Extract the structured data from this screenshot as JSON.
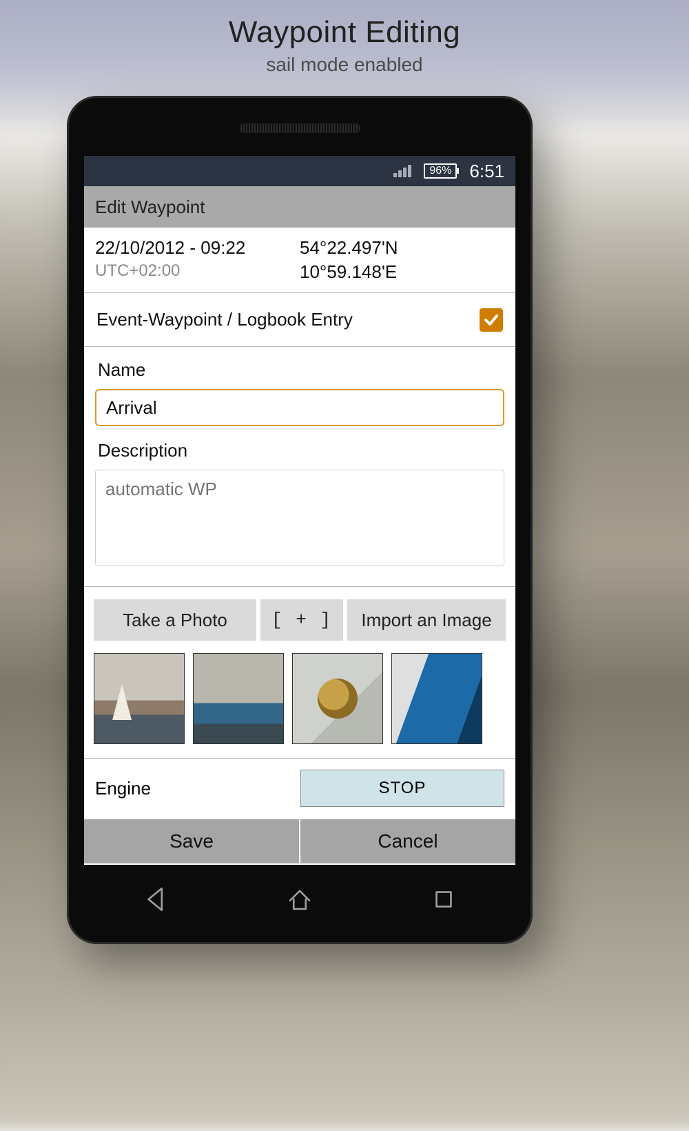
{
  "page": {
    "title": "Waypoint Editing",
    "subtitle": "sail mode enabled"
  },
  "status": {
    "battery": "96%",
    "time": "6:51"
  },
  "header": {
    "title": "Edit Waypoint"
  },
  "info": {
    "datetime": "22/10/2012 - 09:22",
    "timezone": "UTC+02:00",
    "latitude": "54°22.497'N",
    "longitude": "10°59.148'E"
  },
  "event": {
    "label": "Event-Waypoint / Logbook Entry",
    "checked": true
  },
  "form": {
    "name_label": "Name",
    "name_value": "Arrival",
    "desc_label": "Description",
    "desc_placeholder": "automatic WP"
  },
  "photos": {
    "take_label": "Take a Photo",
    "add_label": "[ + ]",
    "import_label": "Import an Image"
  },
  "engine": {
    "label": "Engine",
    "button": "STOP"
  },
  "actions": {
    "save": "Save",
    "cancel": "Cancel"
  }
}
